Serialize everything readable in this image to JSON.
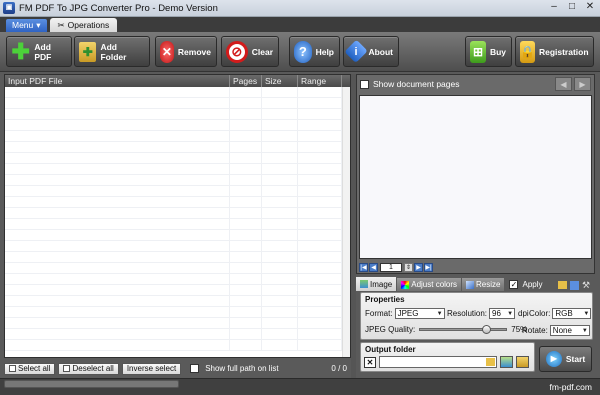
{
  "window": {
    "title": "FM PDF To JPG Converter Pro - Demo Version"
  },
  "menubar": {
    "menu_label": "Menu",
    "operations_tab": "Operations"
  },
  "toolbar": {
    "add_pdf": "Add PDF",
    "add_folder": "Add Folder",
    "remove": "Remove",
    "clear": "Clear",
    "help": "Help",
    "about": "About",
    "buy": "Buy",
    "registration": "Registration"
  },
  "file_table": {
    "columns": [
      "Input PDF File",
      "Pages",
      "Size",
      "Range"
    ],
    "rows": []
  },
  "preview": {
    "show_pages_label": "Show document pages",
    "page_number": "1"
  },
  "tabs": {
    "image": "Image",
    "adjust_colors": "Adjust colors",
    "resize": "Resize",
    "apply": "Apply"
  },
  "properties": {
    "heading": "Properties",
    "format_label": "Format:",
    "format_value": "JPEG",
    "resolution_label": "Resolution:",
    "resolution_value": "96",
    "dpi_label": "dpi",
    "color_label": "Color:",
    "color_value": "RGB",
    "quality_label": "JPEG Quality:",
    "quality_value": "75%",
    "quality_level": 0.75,
    "rotate_label": "Rotate:",
    "rotate_value": "None"
  },
  "output": {
    "heading": "Output folder",
    "path": ""
  },
  "start_button": "Start",
  "bottom": {
    "select_all": "Select all",
    "deselect_all": "Deselect all",
    "inverse_select": "Inverse select",
    "full_path_label": "Show full path on list",
    "count": "0 / 0"
  },
  "status": {
    "site": "fm-pdf.com"
  },
  "colors": {
    "accent": "#2f63c3",
    "toolbar_bg": "#4e4e4e",
    "panel_bg": "#6a6a6a"
  }
}
